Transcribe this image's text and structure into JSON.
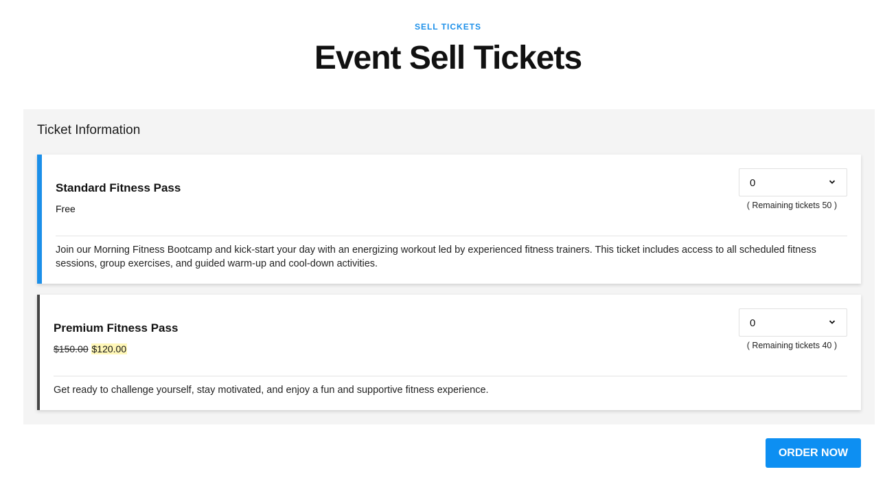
{
  "header": {
    "eyebrow": "SELL TICKETS",
    "title": "Event Sell Tickets"
  },
  "panel": {
    "title": "Ticket Information"
  },
  "tickets": [
    {
      "name": "Standard Fitness Pass",
      "price": "Free",
      "quantity": "0",
      "remaining": "( Remaining tickets 50 )",
      "description": "Join our Morning Fitness Bootcamp and kick-start your day with an energizing workout led by experienced fitness trainers. This ticket includes access to all scheduled fitness sessions, group exercises, and guided warm-up and cool-down activities.",
      "accent_color": "#1b8fe9"
    },
    {
      "name": "Premium Fitness Pass",
      "old_price": "$150.00",
      "new_price": "$120.00",
      "quantity": "0",
      "remaining": "( Remaining tickets 40 )",
      "description": "Get ready to challenge yourself, stay motivated, and enjoy a fun and supportive fitness experience.",
      "accent_color": "#444444"
    }
  ],
  "actions": {
    "order_label": "ORDER NOW"
  },
  "colors": {
    "brand": "#0d8ff2",
    "panel_bg": "#f4f4f4",
    "highlight": "#fff7b8"
  },
  "icons": {
    "quantity_dropdown": "chevron-down-icon"
  }
}
